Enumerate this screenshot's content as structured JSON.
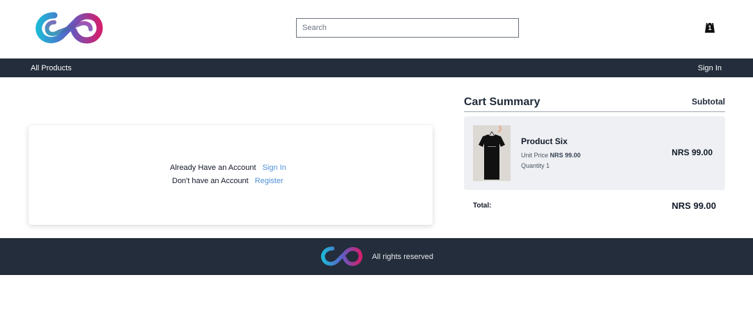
{
  "header": {
    "search": {
      "placeholder": "Search",
      "value": ""
    },
    "cart_count": "1"
  },
  "nav": {
    "all_products": "All Products",
    "sign_in": "Sign In"
  },
  "account": {
    "have_account_label": "Already Have an Account",
    "sign_in_link": "Sign In",
    "no_account_label": "Don't have an Account",
    "register_link": "Register"
  },
  "cart_summary": {
    "title": "Cart Summary",
    "subtotal_heading": "Subtotal",
    "items": [
      {
        "name": "Product Six",
        "unit_price_label": "Unit Price",
        "unit_price": "NRS 99.00",
        "quantity_text": "Quantity 1",
        "line_total": "NRS 99.00"
      }
    ],
    "total_label": "Total:",
    "total_value": "NRS 99.00"
  },
  "footer": {
    "text": "All rights reserved"
  },
  "colors": {
    "nav_bg": "#232d3b",
    "link": "#4f8fd8",
    "cart_item_bg": "#eef0f3"
  },
  "icons": {
    "logo": "infinity-logo",
    "cart": "shopping-bag-icon"
  }
}
